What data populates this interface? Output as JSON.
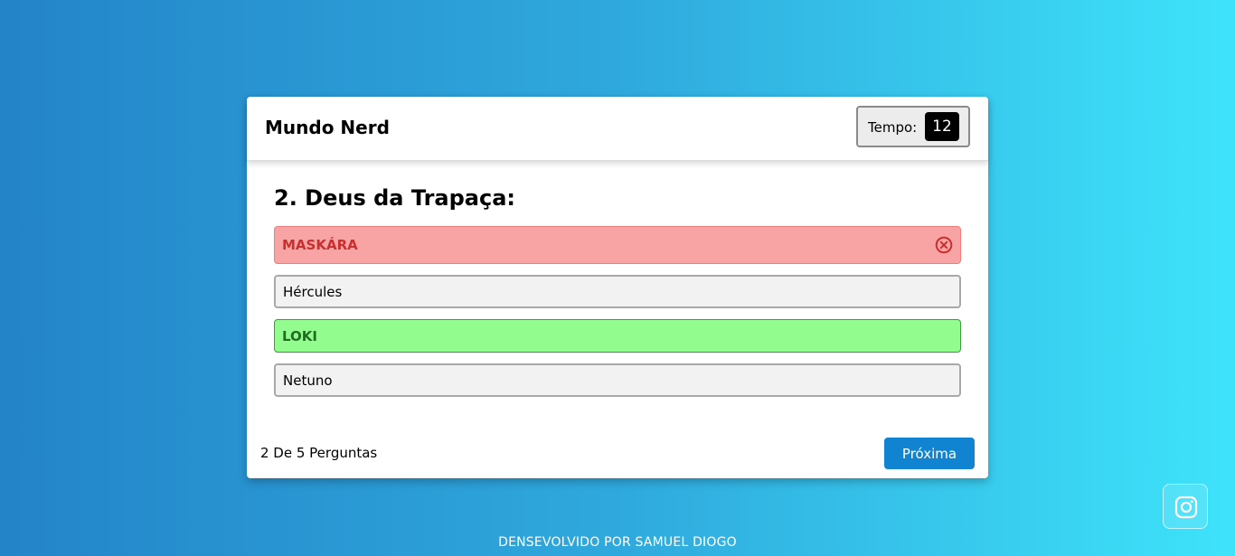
{
  "header": {
    "title": "Mundo Nerd",
    "timer_label": "Tempo:",
    "timer_value": "12"
  },
  "question": {
    "text": "2. Deus da Trapaça:"
  },
  "options": [
    {
      "label": "MASKÁRA",
      "state": "wrong"
    },
    {
      "label": "Hércules",
      "state": "neutral"
    },
    {
      "label": "LOKI",
      "state": "correct"
    },
    {
      "label": "Netuno",
      "state": "neutral"
    }
  ],
  "footer": {
    "progress": "2 De 5 Perguntas",
    "next_label": "Próxima"
  },
  "credit": "DENSEVOLVIDO POR SAMUEL DIOGO",
  "icons": {
    "wrong": "close-circle-icon",
    "social": "instagram-icon"
  },
  "colors": {
    "wrong_bg": "#f9a4a4",
    "wrong_text": "#c92f2f",
    "correct_bg": "#92fc8e",
    "correct_text": "#1f6e1f",
    "accent": "#1184d1"
  }
}
